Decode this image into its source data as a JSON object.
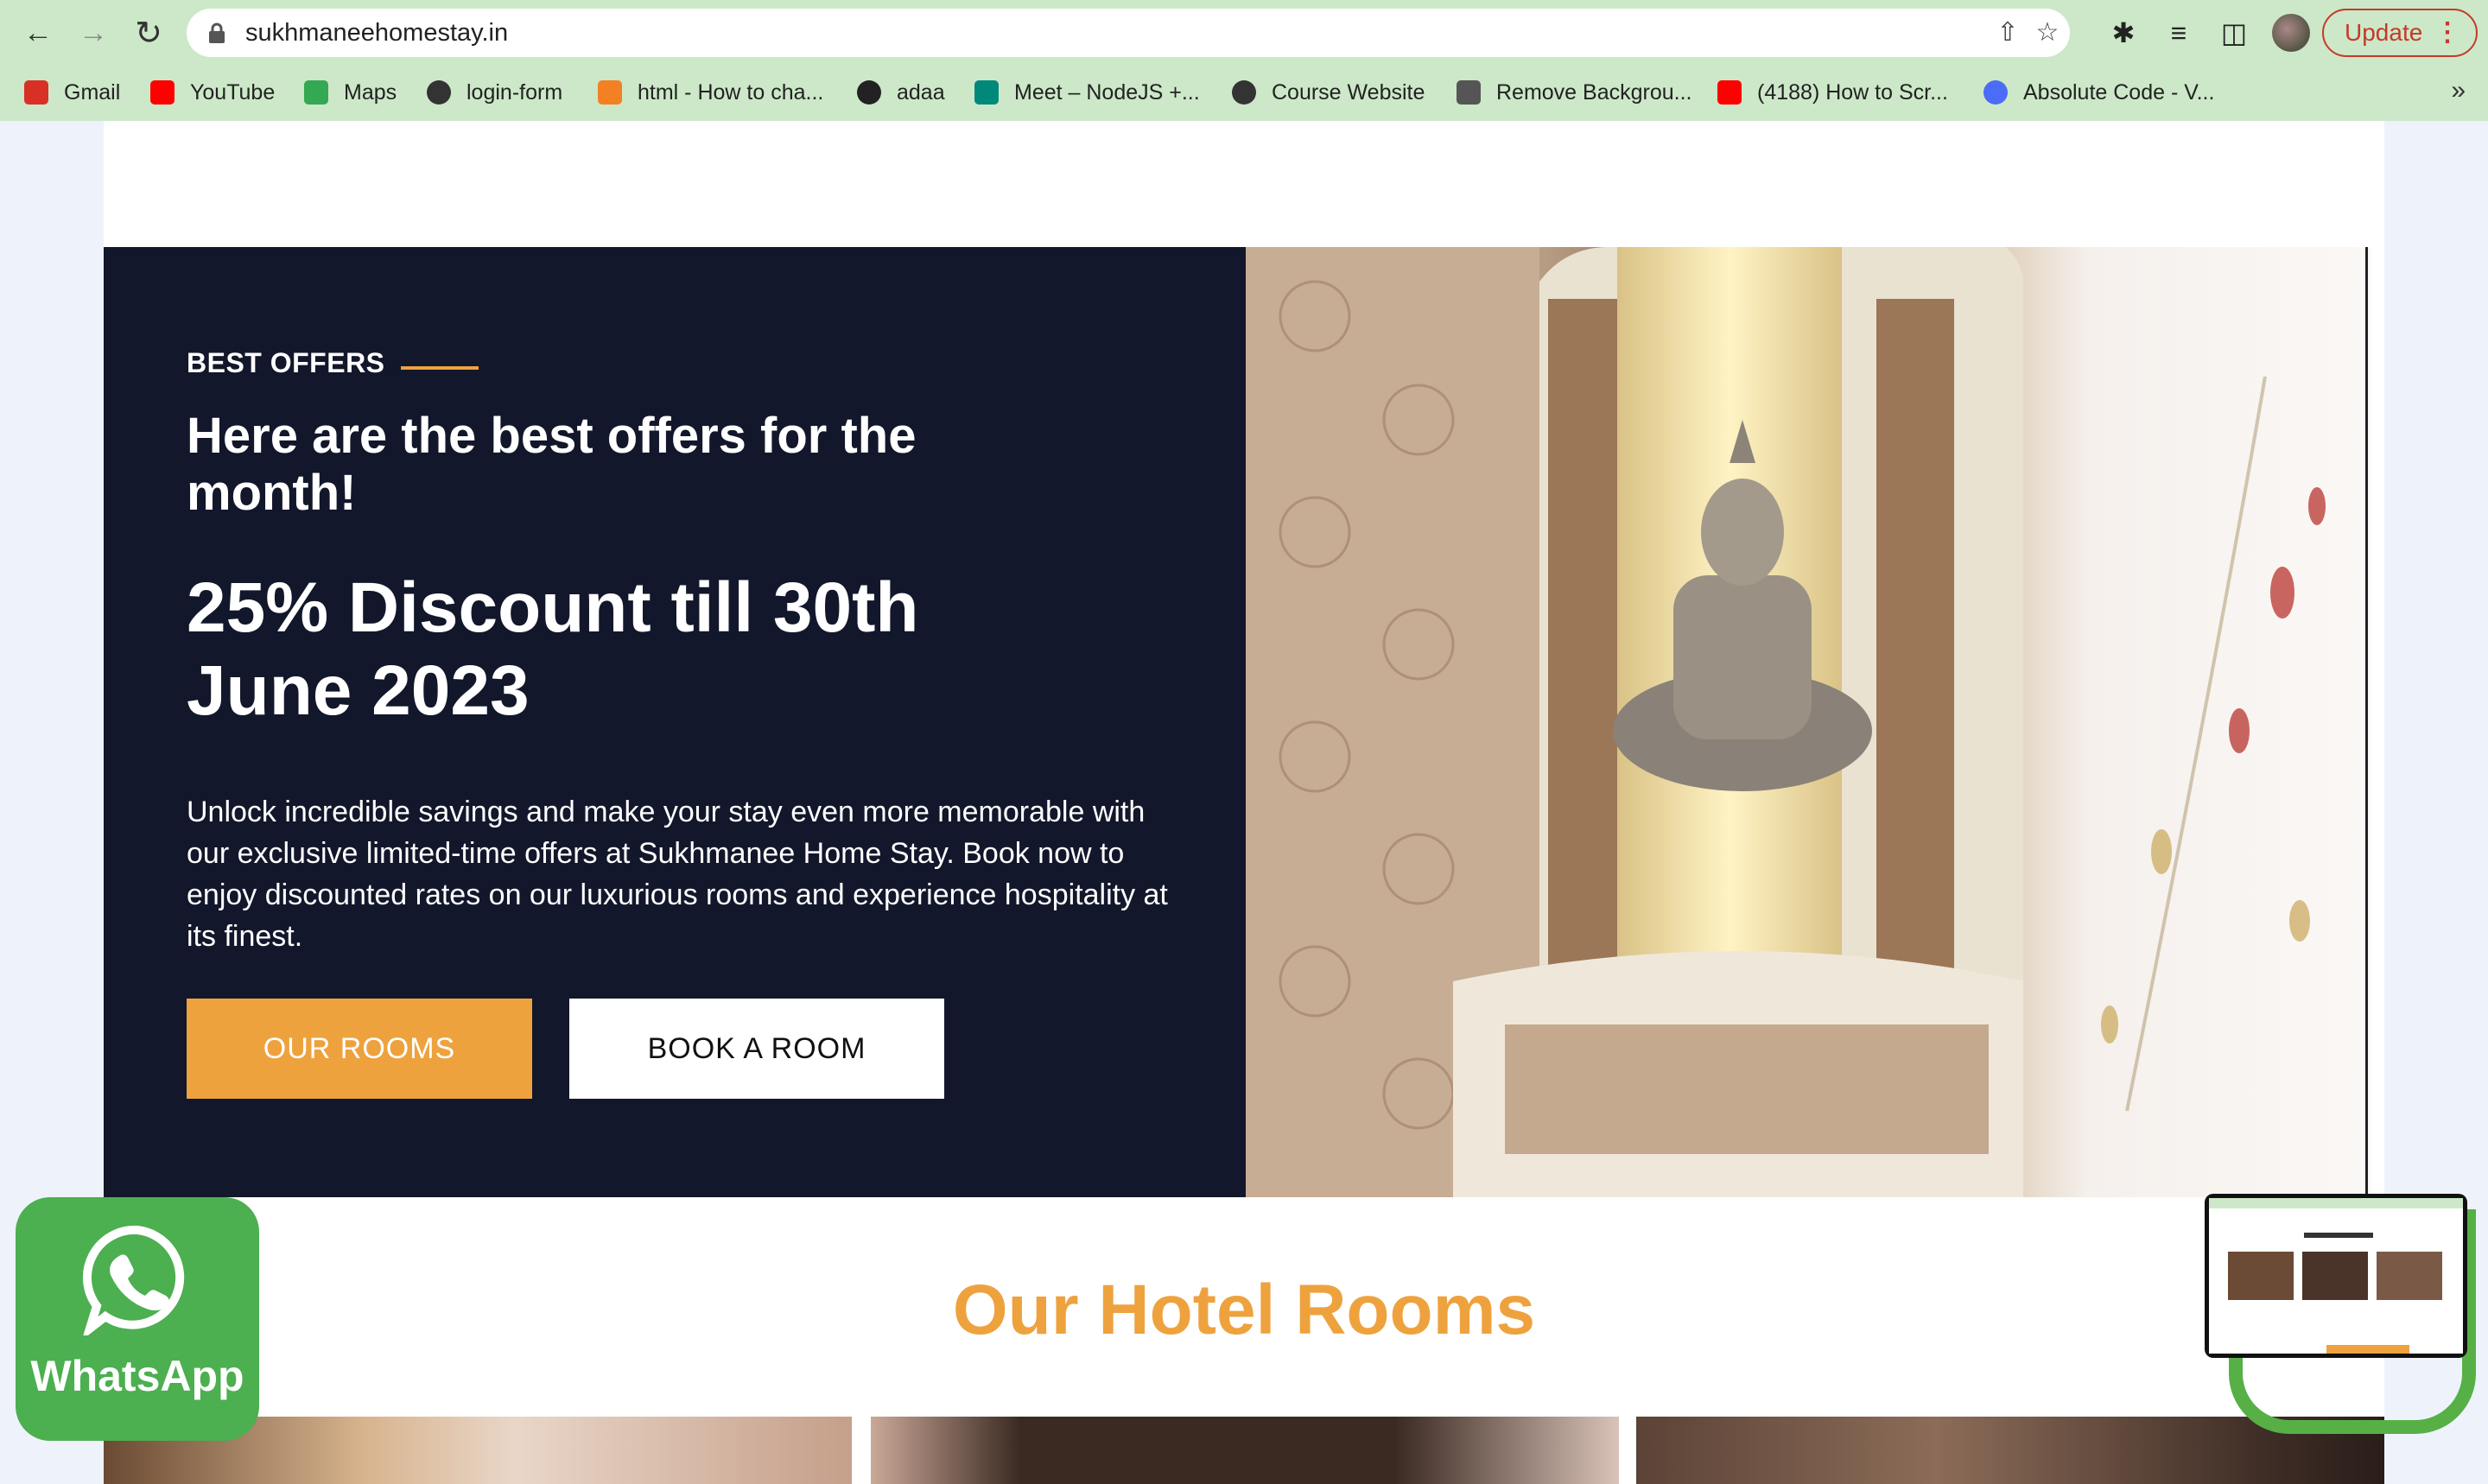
{
  "browser": {
    "url": "sukhmaneehomestay.in",
    "update_label": "Update",
    "bookmarks": [
      {
        "label": "Gmail",
        "icon": "gmail-icon",
        "color": "#d93025"
      },
      {
        "label": "YouTube",
        "icon": "youtube-icon",
        "color": "#ff0000"
      },
      {
        "label": "Maps",
        "icon": "maps-icon",
        "color": "#34a853"
      },
      {
        "label": "login-form",
        "icon": "globe-icon",
        "color": "#333333"
      },
      {
        "label": "html - How to cha...",
        "icon": "stackoverflow-icon",
        "color": "#f48024"
      },
      {
        "label": "adaa",
        "icon": "dl-icon",
        "color": "#222222"
      },
      {
        "label": "Meet – NodeJS +...",
        "icon": "meet-icon",
        "color": "#00897b"
      },
      {
        "label": "Course Website",
        "icon": "globe-icon",
        "color": "#333333"
      },
      {
        "label": "Remove Backgrou...",
        "icon": "layers-icon",
        "color": "#555555"
      },
      {
        "label": "(4188) How to Scr...",
        "icon": "youtube-icon",
        "color": "#ff0000"
      },
      {
        "label": "Absolute Code - V...",
        "icon": "c-icon",
        "color": "#4a6cf7"
      }
    ]
  },
  "offer": {
    "eyebrow": "BEST OFFERS",
    "headline": "Here are the best offers for the month!",
    "discount": "25% Discount till 30th June 2023",
    "body": "Unlock incredible savings and make your stay even more memorable with our exclusive limited-time offers at Sukhmanee Home Stay. Book now to enjoy discounted rates on our luxurious rooms and experience hospitality at its finest.",
    "primary_button": "OUR ROOMS",
    "secondary_button": "BOOK A ROOM"
  },
  "rooms": {
    "title": "Our Hotel Rooms"
  },
  "whatsapp": {
    "label": "WhatsApp"
  },
  "colors": {
    "accent": "#eea23e",
    "dark": "#12172b",
    "whatsapp": "#4caf50",
    "chrome": "#cce8c8"
  }
}
